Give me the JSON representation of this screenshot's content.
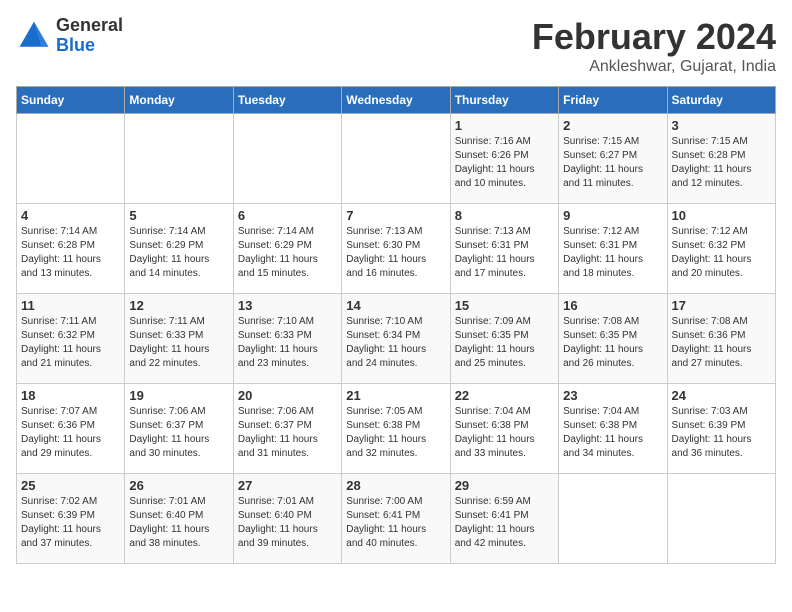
{
  "logo": {
    "general": "General",
    "blue": "Blue"
  },
  "title": "February 2024",
  "location": "Ankleshwar, Gujarat, India",
  "days_of_week": [
    "Sunday",
    "Monday",
    "Tuesday",
    "Wednesday",
    "Thursday",
    "Friday",
    "Saturday"
  ],
  "weeks": [
    [
      {
        "day": "",
        "detail": ""
      },
      {
        "day": "",
        "detail": ""
      },
      {
        "day": "",
        "detail": ""
      },
      {
        "day": "",
        "detail": ""
      },
      {
        "day": "1",
        "detail": "Sunrise: 7:16 AM\nSunset: 6:26 PM\nDaylight: 11 hours\nand 10 minutes."
      },
      {
        "day": "2",
        "detail": "Sunrise: 7:15 AM\nSunset: 6:27 PM\nDaylight: 11 hours\nand 11 minutes."
      },
      {
        "day": "3",
        "detail": "Sunrise: 7:15 AM\nSunset: 6:28 PM\nDaylight: 11 hours\nand 12 minutes."
      }
    ],
    [
      {
        "day": "4",
        "detail": "Sunrise: 7:14 AM\nSunset: 6:28 PM\nDaylight: 11 hours\nand 13 minutes."
      },
      {
        "day": "5",
        "detail": "Sunrise: 7:14 AM\nSunset: 6:29 PM\nDaylight: 11 hours\nand 14 minutes."
      },
      {
        "day": "6",
        "detail": "Sunrise: 7:14 AM\nSunset: 6:29 PM\nDaylight: 11 hours\nand 15 minutes."
      },
      {
        "day": "7",
        "detail": "Sunrise: 7:13 AM\nSunset: 6:30 PM\nDaylight: 11 hours\nand 16 minutes."
      },
      {
        "day": "8",
        "detail": "Sunrise: 7:13 AM\nSunset: 6:31 PM\nDaylight: 11 hours\nand 17 minutes."
      },
      {
        "day": "9",
        "detail": "Sunrise: 7:12 AM\nSunset: 6:31 PM\nDaylight: 11 hours\nand 18 minutes."
      },
      {
        "day": "10",
        "detail": "Sunrise: 7:12 AM\nSunset: 6:32 PM\nDaylight: 11 hours\nand 20 minutes."
      }
    ],
    [
      {
        "day": "11",
        "detail": "Sunrise: 7:11 AM\nSunset: 6:32 PM\nDaylight: 11 hours\nand 21 minutes."
      },
      {
        "day": "12",
        "detail": "Sunrise: 7:11 AM\nSunset: 6:33 PM\nDaylight: 11 hours\nand 22 minutes."
      },
      {
        "day": "13",
        "detail": "Sunrise: 7:10 AM\nSunset: 6:33 PM\nDaylight: 11 hours\nand 23 minutes."
      },
      {
        "day": "14",
        "detail": "Sunrise: 7:10 AM\nSunset: 6:34 PM\nDaylight: 11 hours\nand 24 minutes."
      },
      {
        "day": "15",
        "detail": "Sunrise: 7:09 AM\nSunset: 6:35 PM\nDaylight: 11 hours\nand 25 minutes."
      },
      {
        "day": "16",
        "detail": "Sunrise: 7:08 AM\nSunset: 6:35 PM\nDaylight: 11 hours\nand 26 minutes."
      },
      {
        "day": "17",
        "detail": "Sunrise: 7:08 AM\nSunset: 6:36 PM\nDaylight: 11 hours\nand 27 minutes."
      }
    ],
    [
      {
        "day": "18",
        "detail": "Sunrise: 7:07 AM\nSunset: 6:36 PM\nDaylight: 11 hours\nand 29 minutes."
      },
      {
        "day": "19",
        "detail": "Sunrise: 7:06 AM\nSunset: 6:37 PM\nDaylight: 11 hours\nand 30 minutes."
      },
      {
        "day": "20",
        "detail": "Sunrise: 7:06 AM\nSunset: 6:37 PM\nDaylight: 11 hours\nand 31 minutes."
      },
      {
        "day": "21",
        "detail": "Sunrise: 7:05 AM\nSunset: 6:38 PM\nDaylight: 11 hours\nand 32 minutes."
      },
      {
        "day": "22",
        "detail": "Sunrise: 7:04 AM\nSunset: 6:38 PM\nDaylight: 11 hours\nand 33 minutes."
      },
      {
        "day": "23",
        "detail": "Sunrise: 7:04 AM\nSunset: 6:38 PM\nDaylight: 11 hours\nand 34 minutes."
      },
      {
        "day": "24",
        "detail": "Sunrise: 7:03 AM\nSunset: 6:39 PM\nDaylight: 11 hours\nand 36 minutes."
      }
    ],
    [
      {
        "day": "25",
        "detail": "Sunrise: 7:02 AM\nSunset: 6:39 PM\nDaylight: 11 hours\nand 37 minutes."
      },
      {
        "day": "26",
        "detail": "Sunrise: 7:01 AM\nSunset: 6:40 PM\nDaylight: 11 hours\nand 38 minutes."
      },
      {
        "day": "27",
        "detail": "Sunrise: 7:01 AM\nSunset: 6:40 PM\nDaylight: 11 hours\nand 39 minutes."
      },
      {
        "day": "28",
        "detail": "Sunrise: 7:00 AM\nSunset: 6:41 PM\nDaylight: 11 hours\nand 40 minutes."
      },
      {
        "day": "29",
        "detail": "Sunrise: 6:59 AM\nSunset: 6:41 PM\nDaylight: 11 hours\nand 42 minutes."
      },
      {
        "day": "",
        "detail": ""
      },
      {
        "day": "",
        "detail": ""
      }
    ]
  ]
}
